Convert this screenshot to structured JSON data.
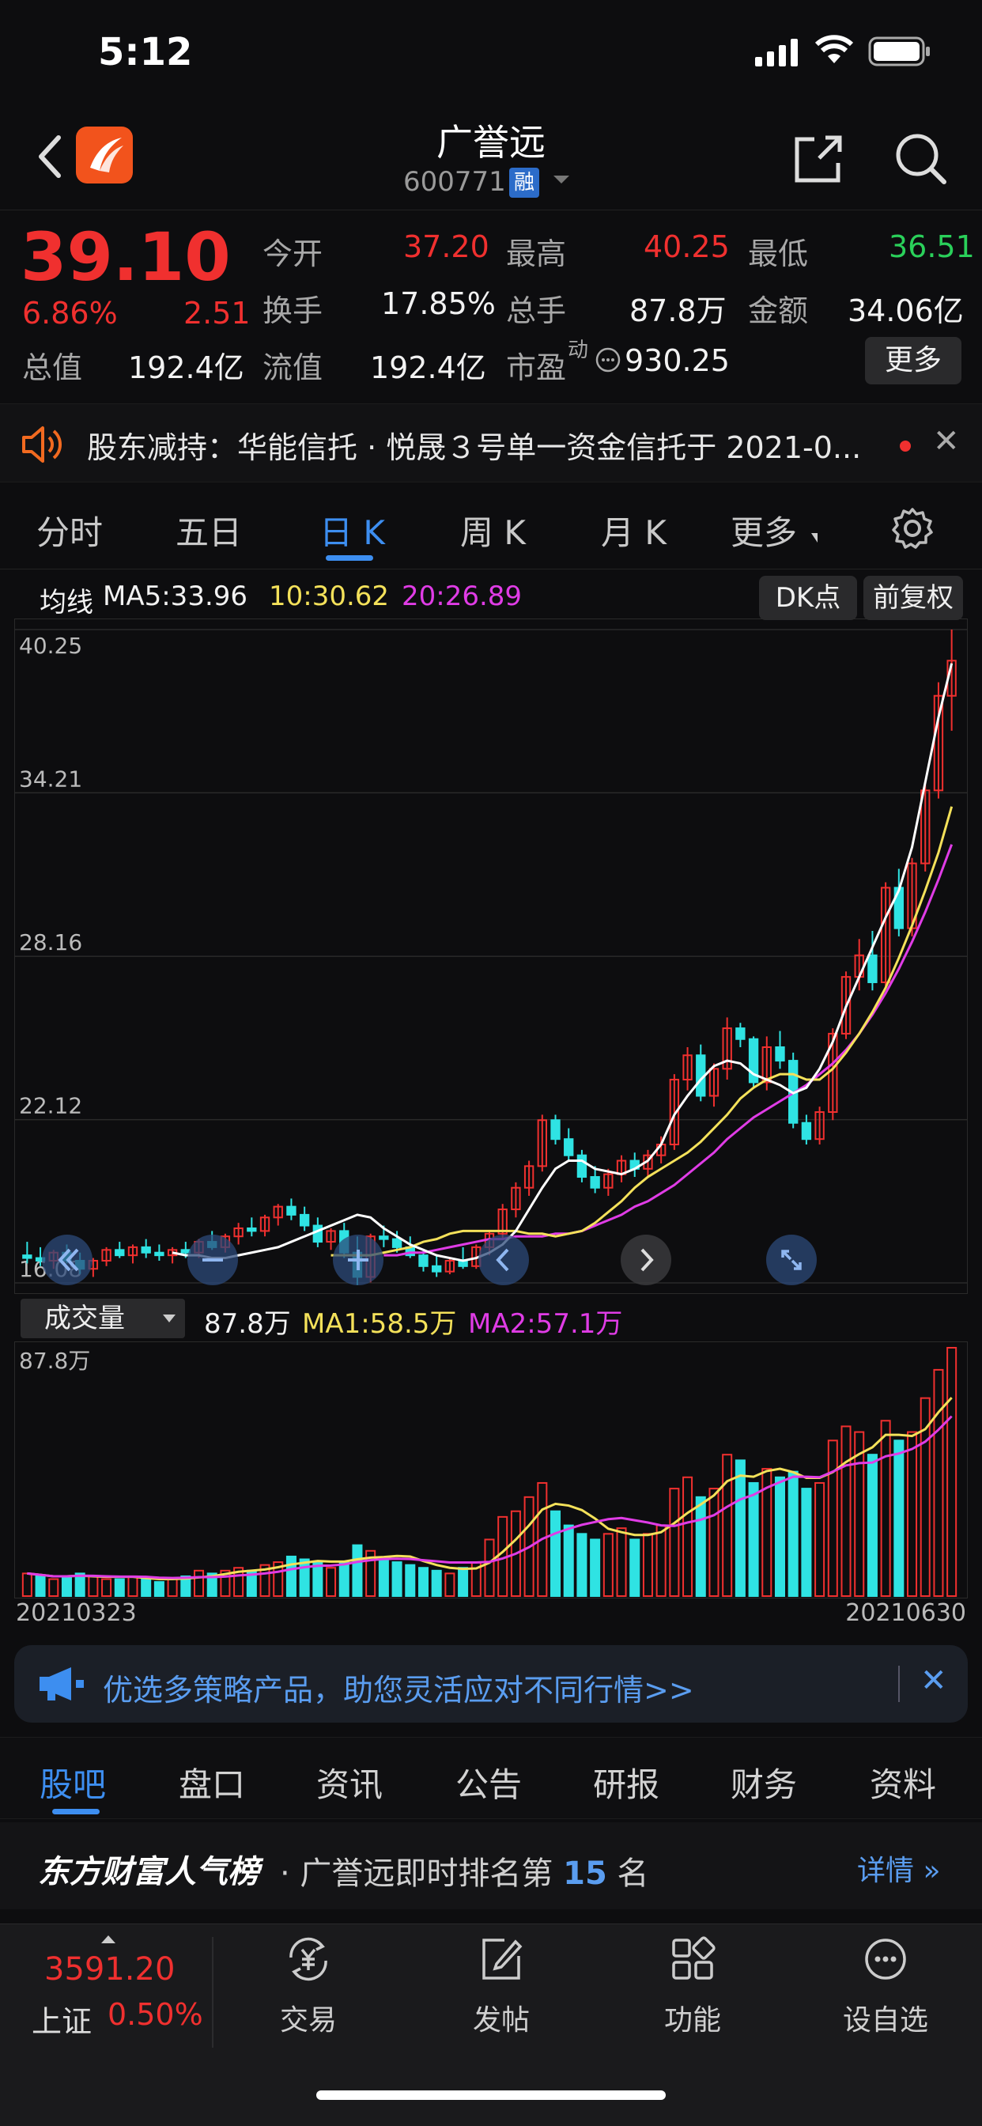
{
  "status_bar": {
    "time": "5:12"
  },
  "header": {
    "title": "广誉远",
    "code": "600771",
    "badge": "融"
  },
  "quote": {
    "price": "39.10",
    "change_pct": "6.86%",
    "change": "2.51",
    "fields": [
      {
        "label": "今开",
        "value": "37.20"
      },
      {
        "label": "最高",
        "value": "40.25"
      },
      {
        "label": "最低",
        "value": "36.51"
      },
      {
        "label": "换手",
        "value": "17.85%"
      },
      {
        "label": "总手",
        "value": "87.8万"
      },
      {
        "label": "金额",
        "value": "34.06亿"
      },
      {
        "label": "总值",
        "value": "192.4亿"
      },
      {
        "label": "流值",
        "value": "192.4亿"
      },
      {
        "label": "市盈",
        "sup": "动",
        "value": "930.25"
      }
    ],
    "more_label": "更多"
  },
  "announcement": {
    "text": "股东减持：华能信托 · 悦晟３号单一资金信托于 2021-0..."
  },
  "period_tabs": [
    "分时",
    "五日",
    "日 K",
    "周 K",
    "月 K",
    "更多"
  ],
  "ma_line": {
    "label": "均线",
    "ma5": "MA5:33.96",
    "ma10": "10:30.62",
    "ma20": "20:26.89",
    "btn_dk": "DK点",
    "btn_fq": "前复权"
  },
  "volume": {
    "selector": "成交量",
    "value": "87.8万",
    "ma1": "MA1:58.5万",
    "ma2": "MA2:57.1万",
    "axis_top": "87.8万"
  },
  "dates": {
    "start": "20210323",
    "end": "20210630"
  },
  "promo": {
    "text": "优选多策略产品，助您灵活应对不同行情>>"
  },
  "content_tabs": [
    "股吧",
    "盘口",
    "资讯",
    "公告",
    "研报",
    "财务",
    "资料"
  ],
  "rank": {
    "brand": "东方财富人气榜",
    "prefix": "· 广誉远即时排名第",
    "rank": "15",
    "suffix": "名",
    "detail": "详情"
  },
  "bottom_bar": {
    "index_value": "3591.20",
    "index_name": "上证",
    "index_pct": "0.50%",
    "items": [
      "交易",
      "发帖",
      "功能",
      "设自选"
    ]
  },
  "colors": {
    "up": "#f0302f",
    "down": "#2fe3e3",
    "ma5": "#ffffff",
    "ma10": "#f4e15a",
    "ma20": "#e03ce6",
    "accent": "#3d8ef0"
  },
  "chart_data": {
    "type": "candlestick",
    "y_ticks": [
      "40.25",
      "34.21",
      "28.16",
      "22.12",
      "16.08"
    ],
    "ylim": [
      16.08,
      40.25
    ],
    "dates": [
      "20210323",
      "20210630"
    ],
    "candles": [
      [
        17.1,
        17.6,
        16.8,
        17.0
      ],
      [
        17.0,
        17.4,
        16.7,
        16.9
      ],
      [
        16.9,
        17.3,
        16.6,
        17.2
      ],
      [
        17.2,
        17.5,
        16.8,
        16.9
      ],
      [
        16.9,
        17.2,
        16.4,
        16.6
      ],
      [
        16.6,
        17.0,
        16.3,
        16.9
      ],
      [
        16.9,
        17.4,
        16.7,
        17.3
      ],
      [
        17.3,
        17.6,
        17.0,
        17.1
      ],
      [
        17.1,
        17.5,
        16.8,
        17.4
      ],
      [
        17.4,
        17.7,
        17.0,
        17.2
      ],
      [
        17.2,
        17.5,
        16.9,
        17.1
      ],
      [
        17.1,
        17.4,
        16.8,
        17.3
      ],
      [
        17.3,
        17.6,
        17.0,
        17.2
      ],
      [
        17.2,
        17.7,
        17.0,
        17.6
      ],
      [
        17.6,
        18.0,
        17.3,
        17.4
      ],
      [
        17.4,
        17.9,
        17.2,
        17.8
      ],
      [
        17.8,
        18.3,
        17.5,
        18.1
      ],
      [
        18.1,
        18.5,
        17.8,
        18.0
      ],
      [
        18.0,
        18.6,
        17.8,
        18.5
      ],
      [
        18.5,
        19.0,
        18.2,
        18.9
      ],
      [
        18.9,
        19.2,
        18.4,
        18.6
      ],
      [
        18.6,
        18.9,
        18.0,
        18.2
      ],
      [
        18.2,
        18.5,
        17.4,
        17.6
      ],
      [
        17.6,
        18.1,
        17.3,
        18.0
      ],
      [
        18.0,
        18.3,
        17.0,
        17.2
      ],
      [
        17.2,
        17.8,
        16.0,
        16.3
      ],
      [
        16.3,
        17.9,
        16.1,
        17.8
      ],
      [
        17.8,
        18.2,
        17.4,
        17.7
      ],
      [
        17.7,
        18.0,
        17.2,
        17.4
      ],
      [
        17.4,
        17.8,
        17.0,
        17.1
      ],
      [
        17.1,
        17.3,
        16.5,
        16.7
      ],
      [
        16.7,
        17.1,
        16.3,
        16.5
      ],
      [
        16.5,
        17.0,
        16.4,
        16.9
      ],
      [
        16.9,
        17.4,
        16.6,
        16.7
      ],
      [
        16.7,
        17.5,
        16.6,
        17.4
      ],
      [
        17.4,
        18.0,
        17.1,
        17.9
      ],
      [
        17.9,
        19.0,
        17.7,
        18.8
      ],
      [
        18.8,
        19.8,
        18.5,
        19.6
      ],
      [
        19.6,
        20.6,
        19.3,
        20.4
      ],
      [
        20.4,
        22.3,
        20.2,
        22.1
      ],
      [
        22.1,
        22.3,
        21.2,
        21.4
      ],
      [
        21.4,
        21.8,
        20.6,
        20.8
      ],
      [
        20.8,
        21.0,
        19.8,
        20.0
      ],
      [
        20.0,
        20.4,
        19.4,
        19.6
      ],
      [
        19.6,
        20.3,
        19.3,
        20.1
      ],
      [
        20.1,
        20.8,
        19.8,
        20.6
      ],
      [
        20.6,
        20.9,
        20.0,
        20.3
      ],
      [
        20.3,
        21.0,
        20.0,
        20.8
      ],
      [
        20.8,
        21.5,
        20.5,
        21.2
      ],
      [
        21.2,
        23.8,
        21.0,
        23.6
      ],
      [
        23.6,
        24.8,
        23.2,
        24.5
      ],
      [
        24.5,
        24.9,
        22.8,
        23.0
      ],
      [
        23.0,
        24.2,
        22.6,
        24.0
      ],
      [
        24.0,
        25.9,
        23.6,
        25.5
      ],
      [
        25.5,
        25.7,
        24.8,
        25.1
      ],
      [
        25.1,
        25.2,
        23.3,
        23.5
      ],
      [
        23.5,
        25.2,
        23.2,
        24.8
      ],
      [
        24.8,
        25.4,
        24.0,
        24.3
      ],
      [
        24.3,
        24.6,
        21.8,
        22.0
      ],
      [
        22.0,
        22.3,
        21.2,
        21.4
      ],
      [
        21.4,
        22.6,
        21.2,
        22.4
      ],
      [
        22.4,
        25.5,
        22.1,
        25.3
      ],
      [
        25.3,
        27.6,
        25.1,
        27.4
      ],
      [
        27.4,
        28.8,
        26.9,
        28.2
      ],
      [
        28.2,
        29.1,
        26.9,
        27.2
      ],
      [
        27.2,
        30.9,
        27.0,
        30.7
      ],
      [
        30.7,
        31.4,
        28.9,
        29.2
      ],
      [
        29.2,
        31.8,
        28.9,
        31.6
      ],
      [
        31.6,
        34.5,
        31.3,
        34.3
      ],
      [
        34.3,
        38.3,
        34.0,
        37.8
      ],
      [
        37.8,
        40.25,
        36.51,
        39.1
      ]
    ],
    "volumes": [
      [
        8,
        1
      ],
      [
        7,
        0
      ],
      [
        6,
        1
      ],
      [
        7,
        0
      ],
      [
        8,
        0
      ],
      [
        7,
        1
      ],
      [
        6,
        1
      ],
      [
        6,
        0
      ],
      [
        7,
        1
      ],
      [
        6,
        0
      ],
      [
        5,
        0
      ],
      [
        6,
        1
      ],
      [
        7,
        0
      ],
      [
        9,
        1
      ],
      [
        8,
        0
      ],
      [
        9,
        1
      ],
      [
        10,
        1
      ],
      [
        9,
        0
      ],
      [
        11,
        1
      ],
      [
        12,
        1
      ],
      [
        14,
        0
      ],
      [
        13,
        0
      ],
      [
        12,
        0
      ],
      [
        10,
        1
      ],
      [
        12,
        0
      ],
      [
        18,
        0
      ],
      [
        16,
        1
      ],
      [
        13,
        0
      ],
      [
        12,
        0
      ],
      [
        11,
        0
      ],
      [
        10,
        0
      ],
      [
        9,
        0
      ],
      [
        8,
        1
      ],
      [
        10,
        0
      ],
      [
        12,
        1
      ],
      [
        20,
        1
      ],
      [
        28,
        1
      ],
      [
        30,
        1
      ],
      [
        35,
        1
      ],
      [
        40,
        1
      ],
      [
        30,
        0
      ],
      [
        25,
        0
      ],
      [
        22,
        0
      ],
      [
        20,
        0
      ],
      [
        22,
        1
      ],
      [
        24,
        1
      ],
      [
        20,
        0
      ],
      [
        22,
        1
      ],
      [
        25,
        1
      ],
      [
        38,
        1
      ],
      [
        42,
        1
      ],
      [
        35,
        0
      ],
      [
        38,
        1
      ],
      [
        50,
        1
      ],
      [
        48,
        0
      ],
      [
        40,
        0
      ],
      [
        45,
        1
      ],
      [
        42,
        0
      ],
      [
        44,
        0
      ],
      [
        38,
        0
      ],
      [
        40,
        1
      ],
      [
        55,
        1
      ],
      [
        60,
        1
      ],
      [
        58,
        1
      ],
      [
        50,
        0
      ],
      [
        62,
        1
      ],
      [
        55,
        0
      ],
      [
        58,
        1
      ],
      [
        70,
        1
      ],
      [
        80,
        1
      ],
      [
        87.8,
        1
      ]
    ],
    "ma5": [
      17.2,
      17.1,
      17.1,
      17.0,
      17.0,
      17.1,
      17.2,
      17.3,
      17.4,
      17.6,
      17.8,
      18.0,
      18.2,
      18.4,
      18.6,
      18.5,
      18.1,
      17.8,
      17.5,
      17.3,
      17.1,
      17.0,
      16.9,
      17.0,
      17.2,
      17.5,
      18.0,
      18.8,
      19.6,
      20.3,
      20.6,
      20.6,
      20.3,
      20.2,
      20.1,
      20.3,
      20.6,
      21.2,
      22.3,
      23.0,
      23.6,
      24.1,
      24.3,
      24.2,
      23.8,
      23.6,
      23.4,
      23.1,
      23.3,
      24.0,
      25.0,
      26.3,
      27.4,
      28.5,
      29.6,
      30.6,
      32.2,
      34.6,
      37.0,
      39.0
    ],
    "ma10": [
      17.1,
      17.1,
      17.1,
      17.1,
      17.2,
      17.3,
      17.4,
      17.6,
      17.7,
      17.9,
      18.0,
      18.0,
      18.0,
      18.0,
      18.0,
      17.9,
      17.9,
      17.8,
      17.9,
      18.0,
      18.3,
      18.7,
      19.1,
      19.6,
      20.0,
      20.3,
      20.6,
      20.9,
      21.3,
      21.8,
      22.3,
      22.9,
      23.3,
      23.6,
      23.8,
      23.8,
      23.6,
      23.6,
      24.0,
      24.6,
      25.3,
      26.1,
      27.0,
      28.1,
      29.3,
      30.6,
      32.0,
      33.7
    ],
    "ma20": [
      17.1,
      17.1,
      17.2,
      17.2,
      17.3,
      17.4,
      17.5,
      17.6,
      17.7,
      17.7,
      17.8,
      17.8,
      17.8,
      17.9,
      17.9,
      18.0,
      18.2,
      18.4,
      18.6,
      18.9,
      19.1,
      19.4,
      19.7,
      20.1,
      20.5,
      20.9,
      21.4,
      21.8,
      22.2,
      22.5,
      22.8,
      23.1,
      23.4,
      23.8,
      24.2,
      24.7,
      25.3,
      26.0,
      26.8,
      27.7,
      28.7,
      29.8,
      31.0,
      32.3
    ]
  }
}
